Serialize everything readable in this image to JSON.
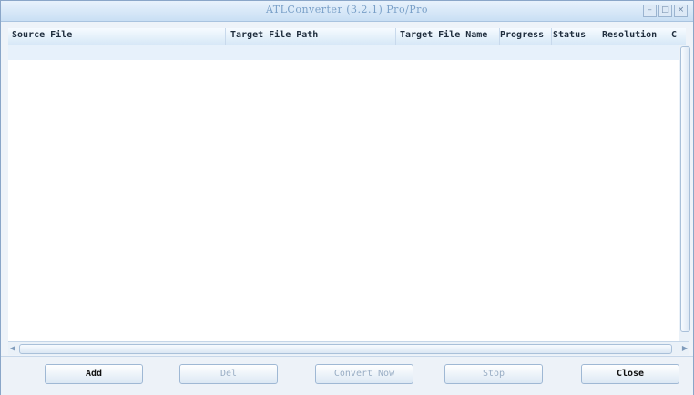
{
  "window": {
    "title": "ATLConverter (3.2.1) Pro/Pro",
    "controls": {
      "minimize": "–",
      "maximize": "□",
      "close": "×"
    }
  },
  "table": {
    "columns": [
      "Source File",
      "Target File Path",
      "Target File Name",
      "Progress",
      "Status",
      "Resolution",
      "C"
    ],
    "rows": []
  },
  "buttons": {
    "add": "Add",
    "del": "Del",
    "convert": "Convert Now",
    "stop": "Stop",
    "close": "Close"
  }
}
